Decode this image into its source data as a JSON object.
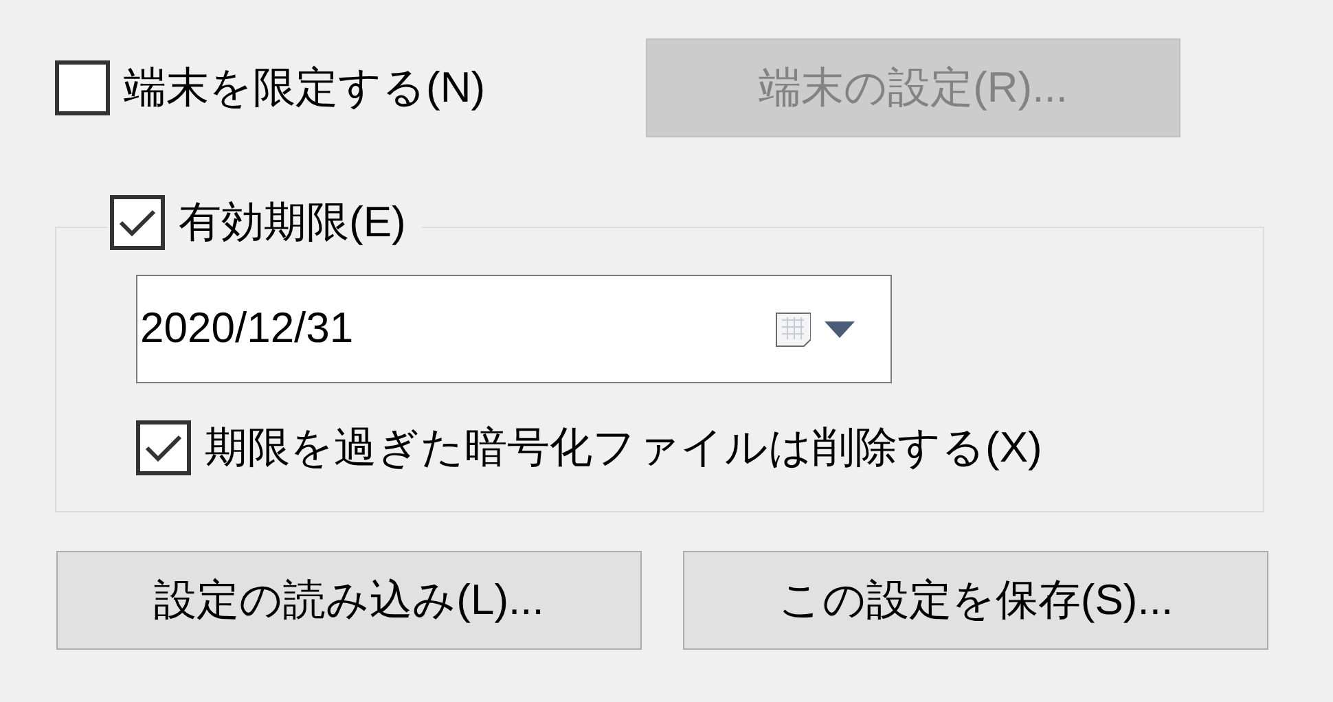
{
  "restrict_terminal": {
    "label": "端末を限定する(N)",
    "checked": false
  },
  "terminal_settings_button": {
    "label": "端末の設定(R)...",
    "disabled": true
  },
  "expiry": {
    "label": "有効期限(E)",
    "checked": true,
    "date": "2020/12/31",
    "delete_expired": {
      "label": "期限を過ぎた暗号化ファイルは削除する(X)",
      "checked": true
    }
  },
  "buttons": [
    {
      "label": "設定の読み込み(L)..."
    },
    {
      "label": "この設定を保存(S)..."
    }
  ]
}
